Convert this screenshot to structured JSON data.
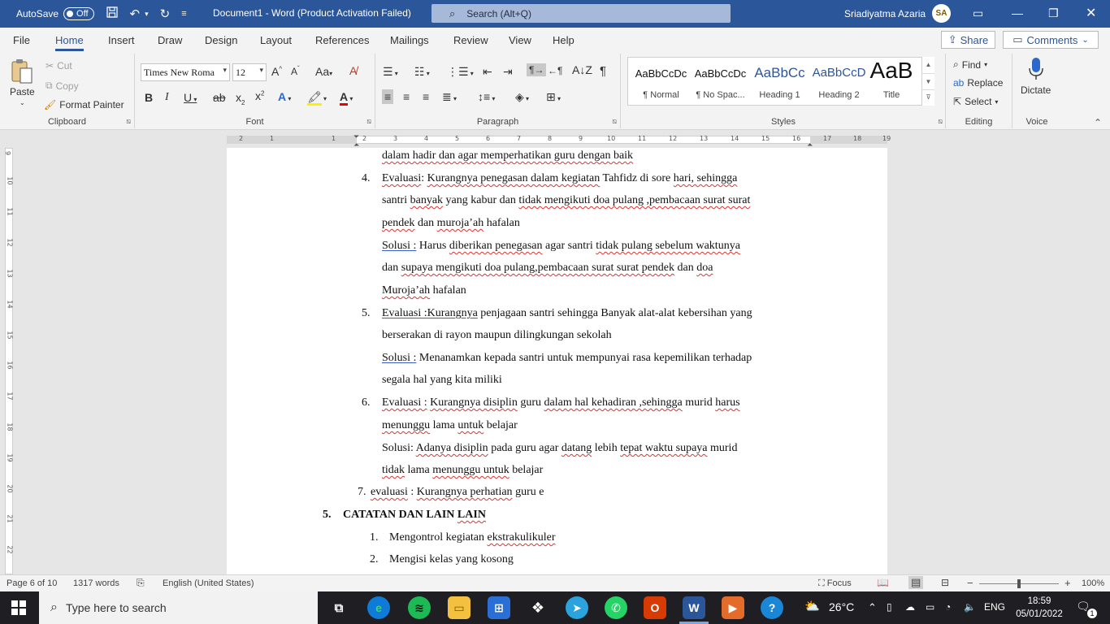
{
  "titlebar": {
    "autosave_label": "AutoSave",
    "autosave_state": "Off",
    "doc_title": "Document1  -  Word (Product Activation Failed)",
    "search_placeholder": "Search (Alt+Q)",
    "user_name": "Sriadiyatma Azaria",
    "avatar_text": "SA"
  },
  "menu": {
    "tabs": [
      "File",
      "Home",
      "Insert",
      "Draw",
      "Design",
      "Layout",
      "References",
      "Mailings",
      "Review",
      "View",
      "Help"
    ],
    "active_tab": "Home",
    "share_label": "Share",
    "comments_label": "Comments"
  },
  "ribbon": {
    "clipboard": {
      "label": "Clipboard",
      "paste": "Paste",
      "cut": "Cut",
      "copy": "Copy",
      "format_painter": "Format Painter"
    },
    "font": {
      "label": "Font",
      "font_name": "Times New Roma",
      "font_size": "12"
    },
    "paragraph": {
      "label": "Paragraph"
    },
    "styles": {
      "label": "Styles",
      "items": [
        {
          "preview": "AaBbCcDc",
          "name": "¶ Normal"
        },
        {
          "preview": "AaBbCcDc",
          "name": "¶ No Spac..."
        },
        {
          "preview": "AaBbCc",
          "name": "Heading 1"
        },
        {
          "preview": "AaBbCcD",
          "name": "Heading 2"
        },
        {
          "preview": "AaB",
          "name": "Title"
        }
      ]
    },
    "editing": {
      "label": "Editing",
      "find": "Find",
      "replace": "Replace",
      "select": "Select"
    },
    "voice": {
      "label": "Voice",
      "dictate": "Dictate"
    }
  },
  "ruler": {
    "h_numbers": [
      "2",
      "1",
      "1",
      "2",
      "3",
      "4",
      "5",
      "6",
      "7",
      "8",
      "9",
      "10",
      "11",
      "12",
      "13",
      "14",
      "15",
      "16",
      "17",
      "18",
      "19"
    ],
    "v_numbers": [
      "9",
      "10",
      "11",
      "12",
      "13",
      "14",
      "15",
      "16",
      "17",
      "18",
      "19",
      "20",
      "21",
      "22"
    ]
  },
  "document": {
    "l0": "dalam hadir dan agar memperhatikan guru dengan baik",
    "item4": {
      "num": "4.",
      "eval_label": "Evaluasi",
      "eval_text_1": ":  ",
      "eval_text_2": "Kurangnya penegasan dalam kegiatan",
      "eval_text_3": " Tahfidz di sore ",
      "eval_text_4": "hari, sehingga",
      "l2a": "santri ",
      "l2b": "banyak",
      "l2c": " yang kabur dan ",
      "l2d": "tidak mengikuti doa pulang ,pembacaan surat surat",
      "l3a": "pendek",
      "l3b": " dan ",
      "l3c": "muroja’ah",
      "l3d": " hafalan",
      "sol_label": "Solusi :",
      "s1a": " Harus ",
      "s1b": "diberikan penegasan",
      "s1c": " agar santri ",
      "s1d": "tidak pulang sebelum waktunya",
      "s2a": "dan ",
      "s2b": "supaya mengikuti doa pulang,pembacaan surat surat pendek",
      "s2c": " dan ",
      "s2d": "doa",
      "s3a": "Muroja’ah",
      "s3b": " hafalan"
    },
    "item5": {
      "num": "5.",
      "eval_label": "Evaluasi :Kurangnya",
      "e1": " penjagaan santri sehingga Banyak alat-alat kebersihan yang",
      "e2": "berserakan di rayon maupun dilingkungan sekolah",
      "sol_label": "Solusi :",
      "s1": " Menanamkan kepada santri untuk mempunyai rasa kepemilikan terhadap",
      "s2": "segala hal yang kita miliki"
    },
    "item6": {
      "num": "6.",
      "eval_label": "Evaluasi :",
      "e1a": " ",
      "e1b": "Kurangnya disiplin",
      "e1c": " guru ",
      "e1d": "dalam hal kehadiran ,sehingga",
      "e1e": " murid ",
      "e1f": "harus",
      "e2a": "menunggu",
      "e2b": " lama ",
      "e2c": "untuk",
      "e2d": " belajar",
      "s1a": "Solusi:  ",
      "s1b": "Adanya disiplin",
      "s1c": " pada guru agar ",
      "s1d": "datang",
      "s1e": " lebih ",
      "s1f": "tepat waktu supaya",
      "s1g": " murid",
      "s2a": "tidak",
      "s2b": " lama ",
      "s2c": "menunggu untuk",
      "s2d": " belajar"
    },
    "item7": {
      "num": "7.",
      "a": "evaluasi",
      "b": " : ",
      "c": "Kurangnya perhatian",
      "d": " guru e"
    },
    "section5": {
      "num": "5.",
      "title_a": "CATATAN DAN LAIN ",
      "title_b": "LAIN"
    },
    "list": [
      {
        "num": "1.",
        "a": "Mengontrol kegiatan ",
        "b": "ekstrakulikuler"
      },
      {
        "num": "2.",
        "a": "Mengisi kelas yang kosong",
        "b": ""
      }
    ]
  },
  "statusbar": {
    "page": "Page 6 of 10",
    "words": "1317 words",
    "language": "English (United States)",
    "focus": "Focus",
    "zoom": "100%"
  },
  "taskbar": {
    "search_placeholder": "Type here to search",
    "weather": "26°C",
    "lang": "ENG",
    "time": "18:59",
    "date": "05/01/2022",
    "notif_count": "1"
  }
}
